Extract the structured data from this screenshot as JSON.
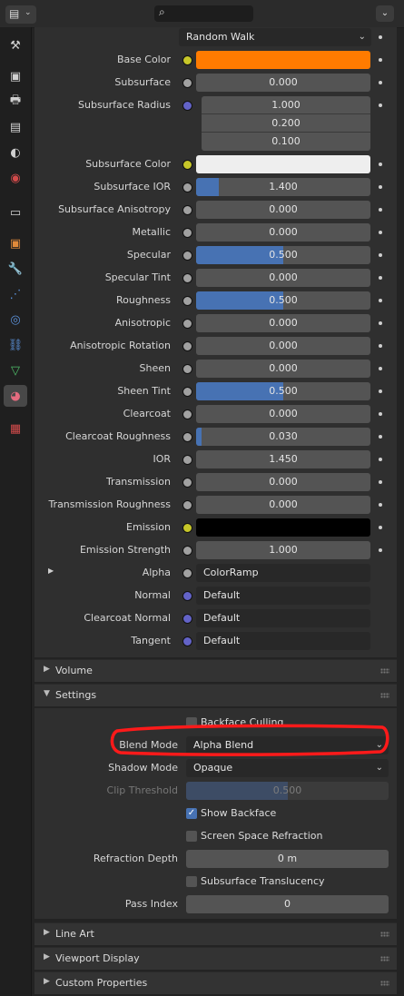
{
  "header": {
    "search": {
      "placeholder": ""
    },
    "dropdown_icon": "chevron-down"
  },
  "tabs": [
    {
      "icon": "tool-icon",
      "glyph": "⚒",
      "color": "#d0d0d0"
    },
    {
      "icon": "render-icon",
      "glyph": "▣",
      "color": "#d0d0d0"
    },
    {
      "icon": "output-icon",
      "glyph": "🖶",
      "color": "#d0d0d0"
    },
    {
      "icon": "view-layer-icon",
      "glyph": "▤",
      "color": "#d0d0d0"
    },
    {
      "icon": "scene-icon",
      "glyph": "◐",
      "color": "#d0d0d0"
    },
    {
      "icon": "world-icon",
      "glyph": "◉",
      "color": "#d24b4b"
    },
    {
      "icon": "collection-icon",
      "glyph": "▭",
      "color": "#d0d0d0"
    },
    {
      "icon": "object-icon",
      "glyph": "▣",
      "color": "#e08a3a"
    },
    {
      "icon": "modifier-icon",
      "glyph": "🔧",
      "color": "#5a8fd6"
    },
    {
      "icon": "particles-icon",
      "glyph": "⋰",
      "color": "#5a8fd6"
    },
    {
      "icon": "physics-icon",
      "glyph": "◎",
      "color": "#5a8fd6"
    },
    {
      "icon": "constraints-icon",
      "glyph": "⛓",
      "color": "#5a8fd6"
    },
    {
      "icon": "data-icon",
      "glyph": "▽",
      "color": "#4fbf6a"
    },
    {
      "icon": "material-icon",
      "glyph": "◕",
      "color": "#e56b7f"
    },
    {
      "icon": "texture-icon",
      "glyph": "▦",
      "color": "#d24b4b"
    }
  ],
  "top_dropdown": "Random Walk",
  "props": [
    {
      "label": "Base Color",
      "kind": "color",
      "color": "#ff7b00",
      "socket": "#c7c729"
    },
    {
      "label": "Subsurface",
      "kind": "num",
      "value": "0.000",
      "fill": 0
    },
    {
      "label": "Subsurface Radius",
      "kind": "vec",
      "values": [
        "1.000",
        "0.200",
        "0.100"
      ],
      "socket": "#6363c7"
    },
    {
      "label": "Subsurface Color",
      "kind": "color",
      "color": "#eeeeee",
      "socket": "#c7c729"
    },
    {
      "label": "Subsurface IOR",
      "kind": "num",
      "value": "1.400",
      "fill": 0.13
    },
    {
      "label": "Subsurface Anisotropy",
      "kind": "num",
      "value": "0.000",
      "fill": 0
    },
    {
      "label": "Metallic",
      "kind": "num",
      "value": "0.000",
      "fill": 0
    },
    {
      "label": "Specular",
      "kind": "num",
      "value": "0.500",
      "fill": 0.5
    },
    {
      "label": "Specular Tint",
      "kind": "num",
      "value": "0.000",
      "fill": 0
    },
    {
      "label": "Roughness",
      "kind": "num",
      "value": "0.500",
      "fill": 0.5
    },
    {
      "label": "Anisotropic",
      "kind": "num",
      "value": "0.000",
      "fill": 0
    },
    {
      "label": "Anisotropic Rotation",
      "kind": "num",
      "value": "0.000",
      "fill": 0
    },
    {
      "label": "Sheen",
      "kind": "num",
      "value": "0.000",
      "fill": 0
    },
    {
      "label": "Sheen Tint",
      "kind": "num",
      "value": "0.500",
      "fill": 0.5
    },
    {
      "label": "Clearcoat",
      "kind": "num",
      "value": "0.000",
      "fill": 0
    },
    {
      "label": "Clearcoat Roughness",
      "kind": "num",
      "value": "0.030",
      "fill": 0.03
    },
    {
      "label": "IOR",
      "kind": "num",
      "value": "1.450",
      "fill": 0
    },
    {
      "label": "Transmission",
      "kind": "num",
      "value": "0.000",
      "fill": 0
    },
    {
      "label": "Transmission Roughness",
      "kind": "num",
      "value": "0.000",
      "fill": 0
    },
    {
      "label": "Emission",
      "kind": "color",
      "color": "#000000",
      "socket": "#c7c729"
    },
    {
      "label": "Emission Strength",
      "kind": "num",
      "value": "1.000",
      "fill": 0
    },
    {
      "label": "Alpha",
      "kind": "link",
      "value": "ColorRamp",
      "socket": "#a1a1a1",
      "expand": true
    },
    {
      "label": "Normal",
      "kind": "link",
      "value": "Default",
      "socket": "#6363c7"
    },
    {
      "label": "Clearcoat Normal",
      "kind": "link",
      "value": "Default",
      "socket": "#6363c7"
    },
    {
      "label": "Tangent",
      "kind": "link",
      "value": "Default",
      "socket": "#6363c7"
    }
  ],
  "sections": {
    "volume": "Volume",
    "settings": "Settings",
    "line_art": "Line Art",
    "viewport_display": "Viewport Display",
    "custom_properties": "Custom Properties"
  },
  "settings": {
    "backface_culling": {
      "label": "Backface Culling",
      "checked": false
    },
    "blend_mode": {
      "label": "Blend Mode",
      "value": "Alpha Blend"
    },
    "shadow_mode": {
      "label": "Shadow Mode",
      "value": "Opaque"
    },
    "clip_threshold": {
      "label": "Clip Threshold",
      "value": "0.500",
      "fill": 0.5
    },
    "show_backface": {
      "label": "Show Backface",
      "checked": true
    },
    "screen_space_refraction": {
      "label": "Screen Space Refraction",
      "checked": false
    },
    "refraction_depth": {
      "label": "Refraction Depth",
      "value": "0 m"
    },
    "subsurface_translucency": {
      "label": "Subsurface Translucency",
      "checked": false
    },
    "pass_index": {
      "label": "Pass Index",
      "value": "0"
    }
  },
  "colors": {
    "accent": "#4772b3",
    "annotation": "#ff1a1a"
  }
}
